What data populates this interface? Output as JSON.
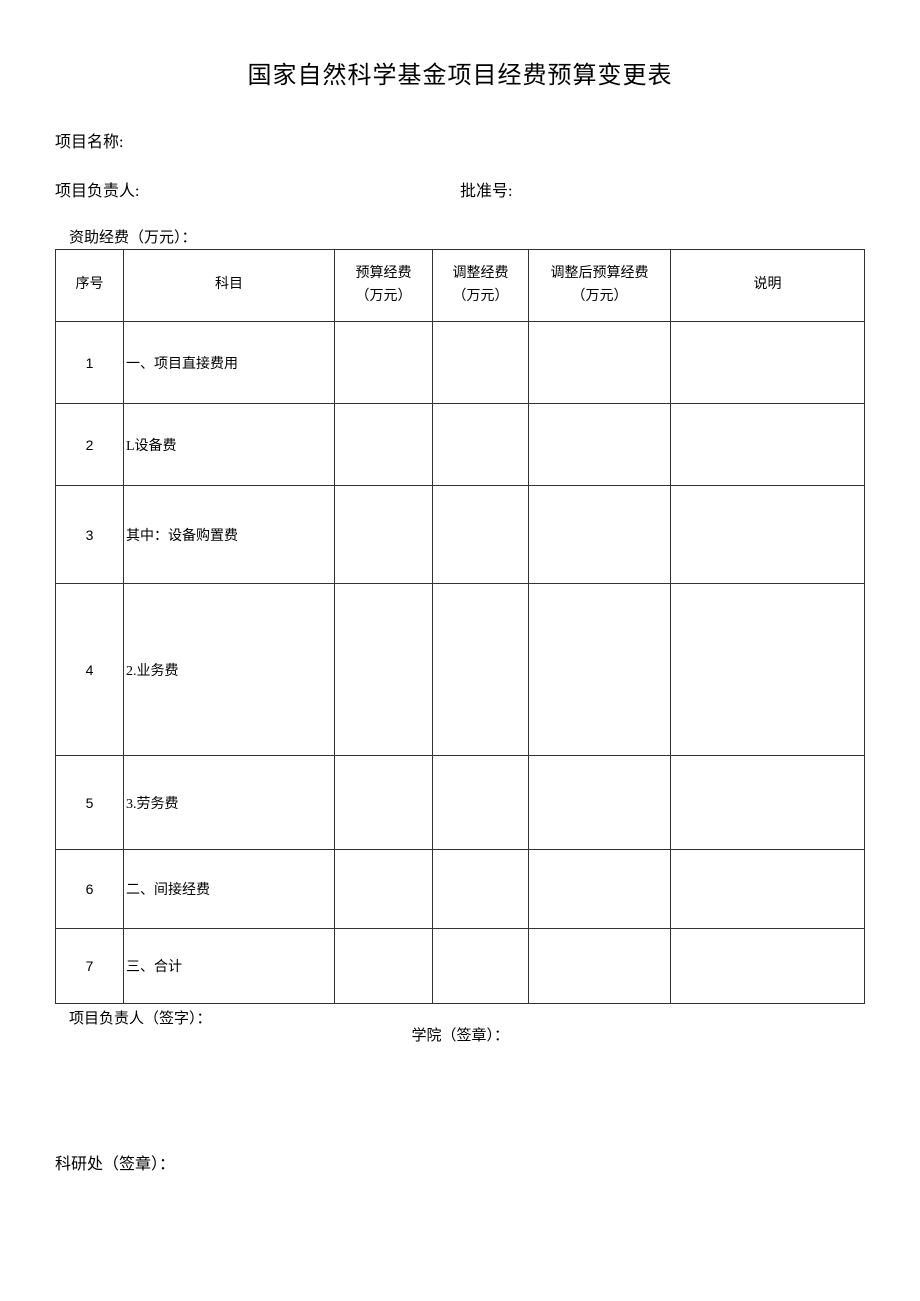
{
  "title": "国家自然科学基金项目经费预算变更表",
  "meta": {
    "project_name_label": "项目名称:",
    "project_leader_label": "项目负责人:",
    "approval_no_label": "批准号:",
    "funding_label": "资助经费（万元）："
  },
  "table": {
    "headers": {
      "seq": "序号",
      "subject": "科目",
      "budget": "预算经费\n（万元）",
      "adjust": "调整经费\n（万元）",
      "after": "调整后预算经费\n（万元）",
      "note": "说明"
    },
    "rows": [
      {
        "seq": "1",
        "subject": "一、项目直接费用",
        "budget": "",
        "adjust": "",
        "after": "",
        "note": ""
      },
      {
        "seq": "2",
        "subject": "L设备费",
        "budget": "",
        "adjust": "",
        "after": "",
        "note": ""
      },
      {
        "seq": "3",
        "subject": "其中：设备购置费",
        "budget": "",
        "adjust": "",
        "after": "",
        "note": ""
      },
      {
        "seq": "4",
        "subject": "2.业务费",
        "budget": "",
        "adjust": "",
        "after": "",
        "note": ""
      },
      {
        "seq": "5",
        "subject": "3.劳务费",
        "budget": "",
        "adjust": "",
        "after": "",
        "note": ""
      },
      {
        "seq": "6",
        "subject": "二、间接经费",
        "budget": "",
        "adjust": "",
        "after": "",
        "note": ""
      },
      {
        "seq": "7",
        "subject": "三、合计",
        "budget": "",
        "adjust": "",
        "after": "",
        "note": ""
      }
    ]
  },
  "signatures": {
    "leader": "项目负责人（签字）：",
    "college": "学院（签章）：",
    "research_office": "科研处（签章）："
  }
}
